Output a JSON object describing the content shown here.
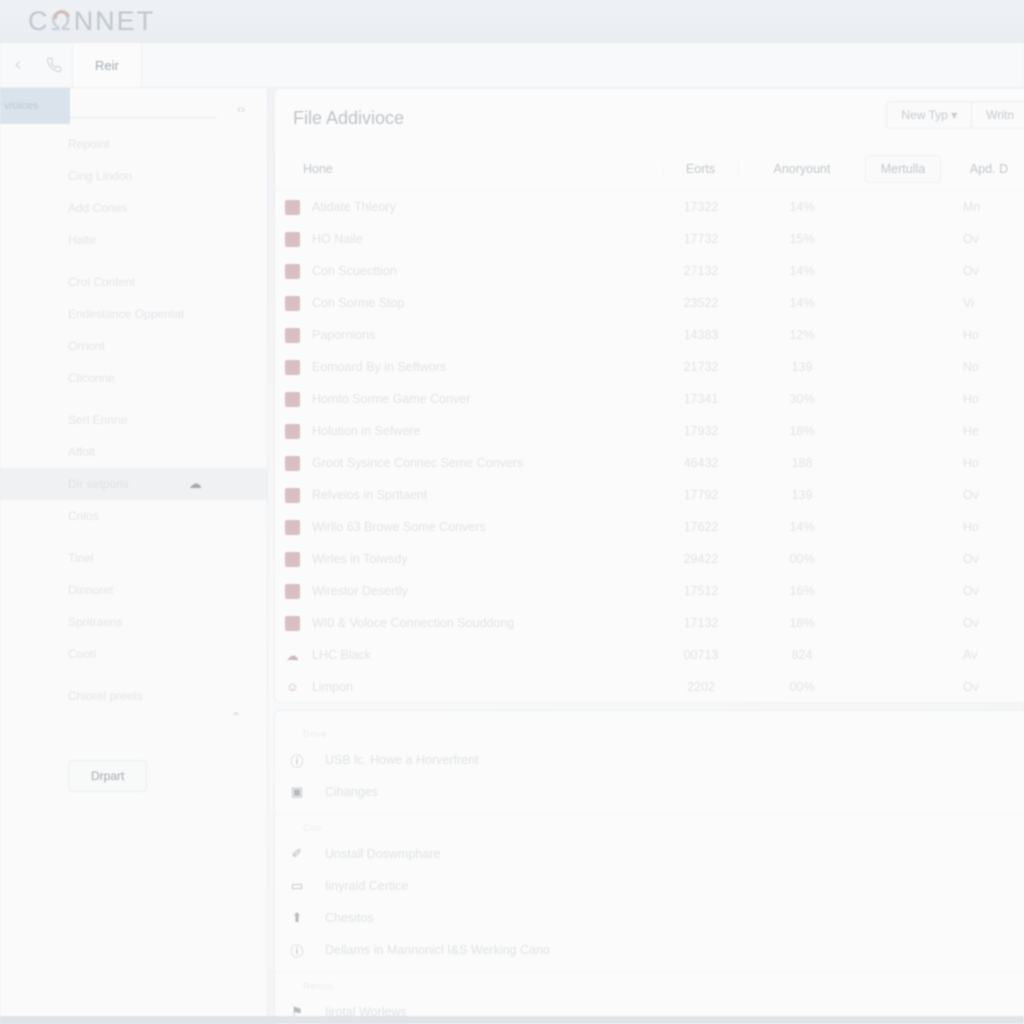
{
  "brand": {
    "name_left": "C",
    "name_mark": "Ω",
    "name_right": "NNET"
  },
  "toolbar": {
    "phone_icon": "phone-icon",
    "back_icon": "back-icon",
    "tabs": [
      {
        "label": "Reir",
        "active": true
      }
    ]
  },
  "sidebar": {
    "selected_chip": "v/oices",
    "collapse_caret": "‹›",
    "chevron_up": "⌃",
    "depart_button": "Drpart",
    "items": [
      {
        "label": "Repoint"
      },
      {
        "label": "Cing Lindon"
      },
      {
        "label": "Add Cones"
      },
      {
        "label": "Halte"
      },
      {
        "label": "Crol Content"
      },
      {
        "label": "Endestance Oppentat"
      },
      {
        "label": "Ornont"
      },
      {
        "label": "Cliconne"
      },
      {
        "label": "Serl Ennne"
      },
      {
        "label": "Affolt"
      },
      {
        "label": "Dir setporls",
        "highlight": true,
        "icon": "cloud-icon"
      },
      {
        "label": "Cnlos"
      },
      {
        "label": "Tinel"
      },
      {
        "label": "Dinnoret"
      },
      {
        "label": "Spritraens"
      },
      {
        "label": "Cootl"
      },
      {
        "label": "Chiorel preets"
      }
    ]
  },
  "main": {
    "title": "File Addivioce",
    "actions": [
      {
        "label": "New Typ ▾",
        "name": "new-type-dropdown"
      },
      {
        "label": "Writn",
        "name": "write-button"
      }
    ],
    "columns": {
      "name": "Hone",
      "c1": "Eorts",
      "c2": "Anoryount",
      "c3": "Mertulla",
      "c4": "Apd. D"
    },
    "rows": [
      {
        "icon": "swatch",
        "name": "Atidate Thleory",
        "c1": "17322",
        "c2": "14%",
        "c3": "",
        "c4": "Mn"
      },
      {
        "icon": "swatch",
        "name": "HO Naile",
        "c1": "17732",
        "c2": "15%",
        "c3": "",
        "c4": "Ov"
      },
      {
        "icon": "swatch",
        "name": "Con Scuecttion",
        "c1": "27132",
        "c2": "14%",
        "c3": "",
        "c4": "Ov"
      },
      {
        "icon": "swatch",
        "name": "Con Sorme Stop",
        "c1": "23522",
        "c2": "14%",
        "c3": "",
        "c4": "Vi"
      },
      {
        "icon": "swatch",
        "name": "Papornions",
        "c1": "14383",
        "c2": "12%",
        "c3": "",
        "c4": "Ho"
      },
      {
        "icon": "swatch",
        "name": "Eomoard By in Seftwors",
        "c1": "21732",
        "c2": "139",
        "c3": "",
        "c4": "No"
      },
      {
        "icon": "swatch",
        "name": "Homto Sorme Game Conver",
        "c1": "17341",
        "c2": "30%",
        "c3": "",
        "c4": "Ho"
      },
      {
        "icon": "swatch",
        "name": "Holution in Sefwere",
        "c1": "17932",
        "c2": "18%",
        "c3": "",
        "c4": "He"
      },
      {
        "icon": "swatch",
        "name": "Groot Sysince Connec Seme Convers",
        "c1": "46432",
        "c2": "188",
        "c3": "",
        "c4": "Ho"
      },
      {
        "icon": "swatch",
        "name": "Relveios in Sprttaent",
        "c1": "17792",
        "c2": "139",
        "c3": "",
        "c4": "Ov"
      },
      {
        "icon": "swatch",
        "name": "Wirllo 63 Browe Some Convers",
        "c1": "17622",
        "c2": "14%",
        "c3": "",
        "c4": "Ho"
      },
      {
        "icon": "swatch",
        "name": "Wirles in Toiwsdy",
        "c1": "29422",
        "c2": "00%",
        "c3": "",
        "c4": "Ov"
      },
      {
        "icon": "swatch",
        "name": "Wirestor Desertly",
        "c1": "17512",
        "c2": "16%",
        "c3": "",
        "c4": "Ov"
      },
      {
        "icon": "swatch",
        "name": "WI0 & Voloce Connection Souddong",
        "c1": "17132",
        "c2": "18%",
        "c3": "",
        "c4": "Ov"
      },
      {
        "icon": "cloud",
        "name": "LHC Black",
        "c1": "00713",
        "c2": "824",
        "c3": "",
        "c4": "Av"
      },
      {
        "icon": "person",
        "name": "Limpon",
        "c1": "2202",
        "c2": "00%",
        "c3": "",
        "c4": "Ov"
      }
    ]
  },
  "lower_list": {
    "sections": [
      {
        "label": "Dove",
        "items": [
          {
            "icon": "bluetooth-icon",
            "glyph": "ⓘ",
            "label": "USB lc. Howe a Horverfrent"
          },
          {
            "icon": "monitor-icon",
            "glyph": "▣",
            "label": "Cihanges"
          }
        ]
      },
      {
        "label": "Coo",
        "items": [
          {
            "icon": "pen-icon",
            "glyph": "✐",
            "label": "Unstall Doswmphare"
          },
          {
            "icon": "window-icon",
            "glyph": "▭",
            "label": "Iinyrald Certice"
          },
          {
            "icon": "upload-icon",
            "glyph": "⬆",
            "label": "Chesitos"
          },
          {
            "icon": "info-icon",
            "glyph": "ⓘ",
            "label": "Dellams in Mannonicl I&S Werking Cano"
          }
        ]
      },
      {
        "label": "Remol",
        "items": [
          {
            "icon": "location-pin-icon",
            "glyph": "⚑",
            "label": "Iirotal Worlews"
          }
        ]
      }
    ]
  },
  "colors": {
    "swatch_pink": "#e9b8c1",
    "accent_blue": "#cfe4f6",
    "logo_arc": "#f0a890",
    "text_muted": "#b8c2cc"
  }
}
